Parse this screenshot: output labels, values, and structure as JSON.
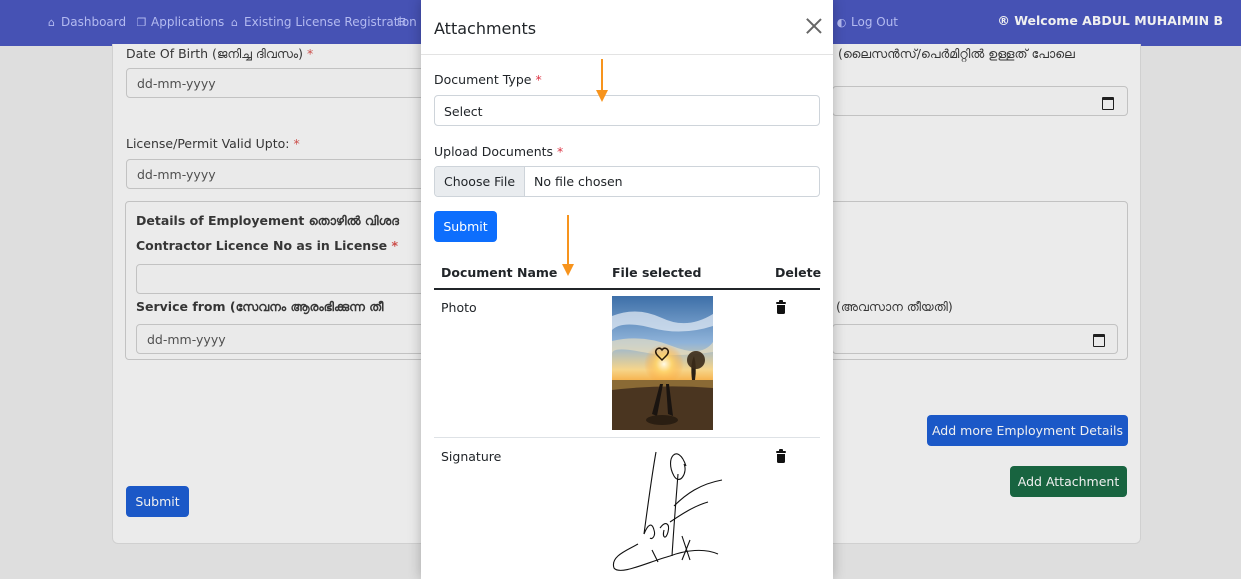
{
  "navbar": {
    "items": [
      {
        "label": "Dashboard",
        "icon": "home-icon"
      },
      {
        "label": "Applications",
        "icon": "applications-icon"
      },
      {
        "label": "Existing License Registration",
        "icon": "home-icon"
      }
    ],
    "logout": "Log Out",
    "welcome": "Welcome ABDUL MUHAIMIN B",
    "colors": {
      "background": "#4b58c0"
    }
  },
  "form": {
    "dob_label": "Date Of Birth (ജനിച്ച ദിവസം)",
    "dob_placeholder": "dd-mm-yyyy",
    "valid_label": "License/Permit Valid Upto:",
    "valid_placeholder": "dd-mm-yyyy",
    "right_label_partial": "(ലൈസൻസ്/പെർമിറ്റിൽ ഉള്ളത് പോലെ",
    "employment_heading": "Details of Employement തൊഴിൽ വിശദ",
    "contractor_label": "Contractor Licence No as in License",
    "service_from_label": "Service from (സേവനം ആരംഭിക്കുന്ന തീ",
    "service_to_label_partial": "(അവസാന തീയതി)",
    "service_from_placeholder": "dd-mm-yyyy",
    "add_employment_button": "Add more Employment Details",
    "add_attachment_button": "Add Attachment",
    "submit_button": "Submit"
  },
  "modal": {
    "title": "Attachments",
    "document_type_label": "Document Type",
    "document_type_value": "Select",
    "upload_label": "Upload Documents",
    "choose_file": "Choose File",
    "no_file": "No file chosen",
    "submit": "Submit",
    "required_mark": "*",
    "table": {
      "headers": [
        "Document Name",
        "File selected",
        "Delete"
      ],
      "rows": [
        {
          "name": "Photo"
        },
        {
          "name": "Signature"
        }
      ]
    }
  },
  "colors": {
    "primary": "#0d6efd",
    "success": "#198754",
    "arrow": "#f7941d"
  }
}
